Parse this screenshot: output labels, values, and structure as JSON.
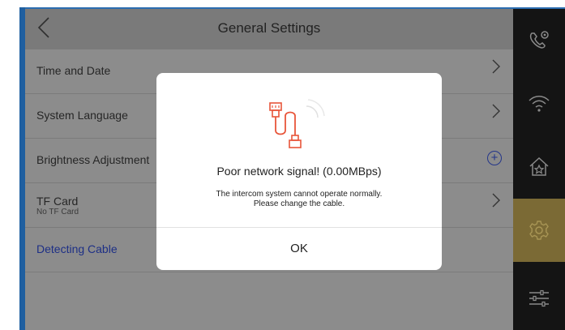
{
  "header": {
    "back_icon": "chevron-left-icon",
    "title": "General Settings"
  },
  "settings": [
    {
      "label": "Time and Date",
      "sub": "",
      "action_icon": "chevron-right-icon"
    },
    {
      "label": "System Language",
      "sub": "",
      "action_icon": "chevron-right-icon"
    },
    {
      "label": "Brightness Adjustment",
      "sub": "",
      "action_icon": "plus-circle-icon"
    },
    {
      "label": "TF Card",
      "sub": "No TF Card",
      "action_icon": "chevron-right-icon"
    },
    {
      "label": "Detecting Cable",
      "sub": ""
    }
  ],
  "sidebar": {
    "items": [
      {
        "icon": "phone-settings-icon"
      },
      {
        "icon": "wifi-icon"
      },
      {
        "icon": "home-icon"
      },
      {
        "icon": "gear-icon",
        "active": true
      },
      {
        "icon": "sliders-icon"
      }
    ],
    "accent_color": "#7b6a35"
  },
  "dialog": {
    "icon": "network-cable-icon",
    "title": "Poor network signal! (0.00MBps)",
    "message_line1": "The intercom system cannot operate normally.",
    "message_line2": "Please change the cable.",
    "ok_label": "OK",
    "icon_color": "#e8553a"
  }
}
